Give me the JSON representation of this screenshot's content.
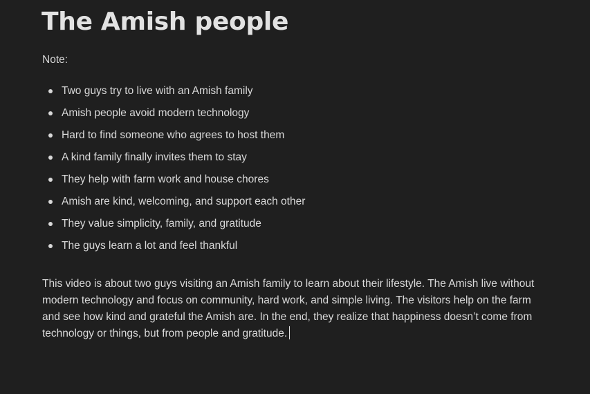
{
  "document": {
    "title": "The Amish people",
    "note_label": "Note:",
    "bullets": [
      "Two guys try to live with an Amish family",
      "Amish people avoid modern technology",
      "Hard to find someone who agrees to host them",
      "A kind family finally invites them to stay",
      "They help with farm work and house chores",
      "Amish are kind, welcoming, and support each other",
      "They value simplicity, family, and gratitude",
      "The guys learn a lot and feel thankful"
    ],
    "summary": "This video is about two guys visiting an Amish family to learn about their lifestyle. The Amish live without modern technology and focus on community, hard work, and simple living. The visitors help on the farm and see how kind and grateful the Amish are. In the end, they realize that happiness doesn’t come from technology or things, but from people and gratitude."
  },
  "colors": {
    "background": "#1f1f1f",
    "text": "#d9d9d9",
    "title": "#e2e2e2"
  }
}
